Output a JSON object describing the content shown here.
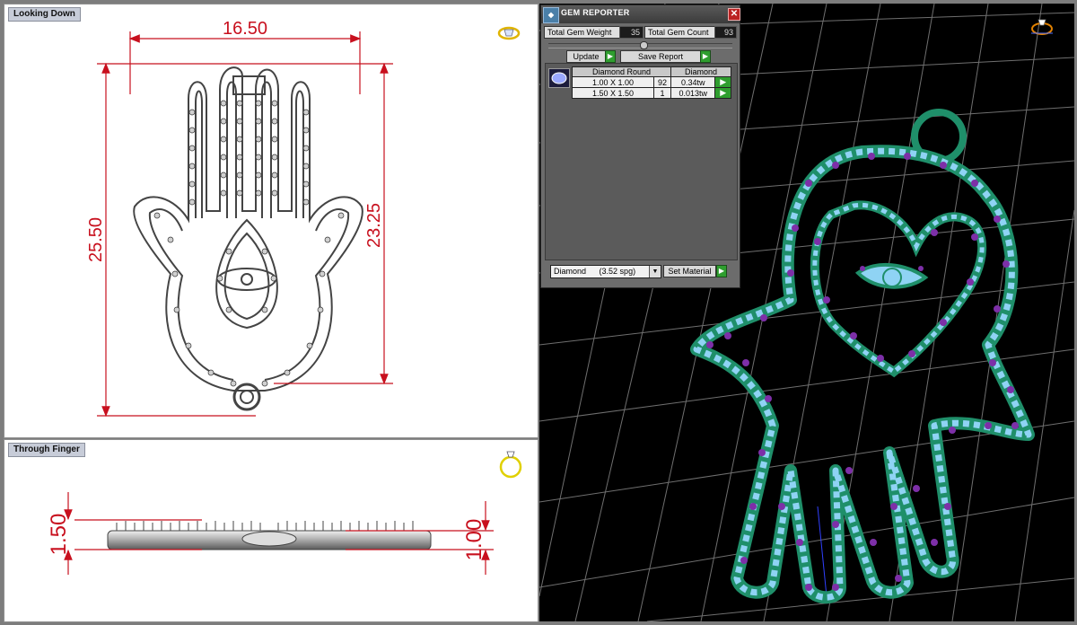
{
  "viewports": {
    "top": {
      "title": "Looking Down"
    },
    "front": {
      "title": "Through Finger"
    }
  },
  "dimensions": {
    "width": "16.50",
    "height_total": "25.50",
    "height_inner": "23.25",
    "thickness_left": "1.50",
    "thickness_right": "1.00"
  },
  "gem_reporter": {
    "title": "GEM REPORTER",
    "total_gem_weight_label": "Total Gem Weight",
    "total_gem_weight_value": "35",
    "total_gem_count_label": "Total Gem Count",
    "total_gem_count_value": "93",
    "update_label": "Update",
    "save_report_label": "Save Report",
    "table": {
      "header_cut": "Diamond Round",
      "header_material": "Diamond",
      "rows": [
        {
          "size": "1.00 X 1.00",
          "count": "92",
          "weight": "0.34tw"
        },
        {
          "size": "1.50 X 1.50",
          "count": "1",
          "weight": "0.013tw"
        }
      ]
    },
    "material_select": "Diamond",
    "material_spg": "(3.52 spg)",
    "set_material_label": "Set Material",
    "close_glyph": "✕",
    "go_glyph": "▶"
  },
  "colors": {
    "dimension": "#c8101e",
    "metal": "#1f8f6a",
    "gem": "#8fd3f4",
    "prong": "#7d2fa8",
    "grid": "#6f6f6f",
    "viewport_icon": "#e0b400"
  },
  "icons": [
    "ring-gem-icon",
    "ring-through-finger-icon",
    "ring-perspective-icon",
    "gem-thumbnail-icon",
    "reporter-logo-icon",
    "close-icon"
  ]
}
